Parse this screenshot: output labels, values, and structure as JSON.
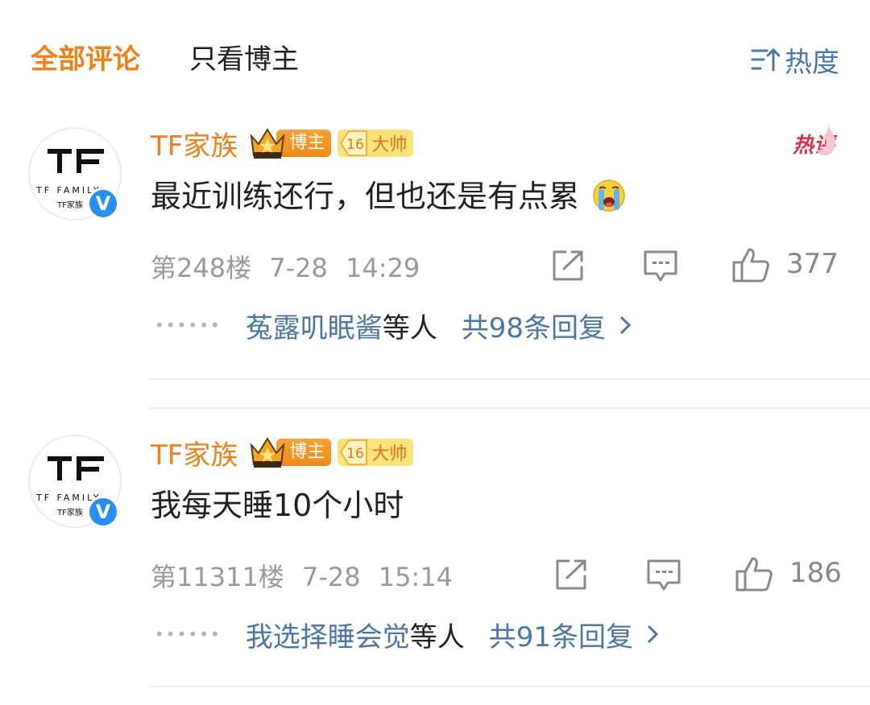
{
  "tabs": {
    "all": "全部评论",
    "blogger_only": "只看博主"
  },
  "sort": {
    "icon": "sort-icon",
    "label": "热度"
  },
  "badges": {
    "blogger": "博主",
    "master_level": "16",
    "master": "大帅"
  },
  "hot_label": "热评",
  "colors": {
    "accent": "#f28019",
    "link": "#4a77a8",
    "hot": "#d9304b",
    "verified": "#2a8ef0"
  },
  "comments": [
    {
      "user": "TF家族",
      "avatar_text": "TF FAMILY",
      "avatar_sub": "TF家族",
      "text": "最近训练还行，但也还是有点累",
      "emoji": "crying-emoji",
      "floor": "第248楼",
      "date": "7-28",
      "time": "14:29",
      "likes": "377",
      "reply_users": "菟露叽眠酱",
      "reply_etc": "等人",
      "reply_total": "共98条回复",
      "hot": true
    },
    {
      "user": "TF家族",
      "avatar_text": "TF FAMILY",
      "avatar_sub": "TF家族",
      "text": "我每天睡10个小时",
      "floor": "第11311楼",
      "date": "7-28",
      "time": "15:14",
      "likes": "186",
      "reply_users": "我选择睡会觉",
      "reply_etc": "等人",
      "reply_total": "共91条回复",
      "hot": false
    }
  ]
}
